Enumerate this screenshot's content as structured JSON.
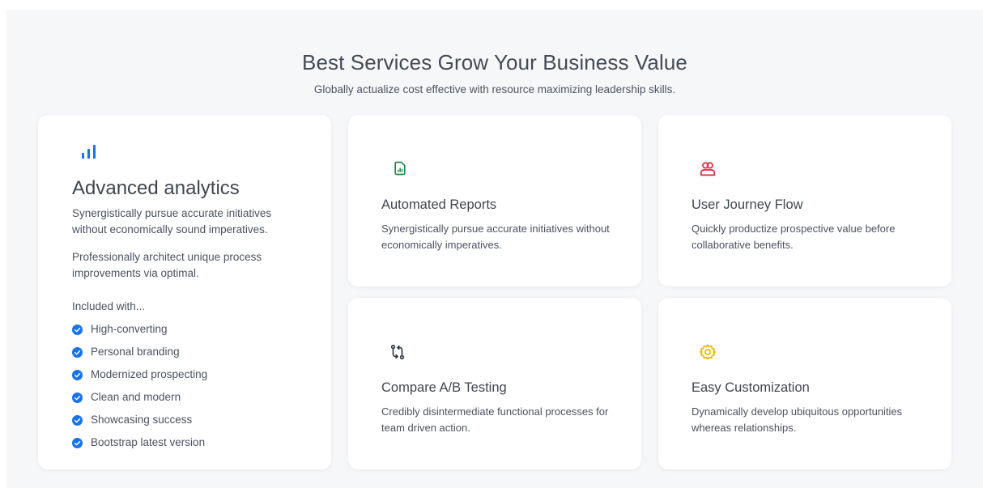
{
  "header": {
    "title": "Best Services Grow Your Business Value",
    "subtitle": "Globally actualize cost effective with resource maximizing leadership skills."
  },
  "featured": {
    "icon": "bar-chart-icon",
    "title": "Advanced analytics",
    "paragraph1": "Synergistically pursue accurate initiatives without economically sound imperatives.",
    "paragraph2": "Professionally architect unique process improvements via optimal.",
    "included_label": "Included with...",
    "features": [
      "High-converting",
      "Personal branding",
      "Modernized prospecting",
      "Clean and modern",
      "Showcasing success",
      "Bootstrap latest version"
    ]
  },
  "services": [
    {
      "icon": "file-chart-icon",
      "title": "Automated Reports",
      "desc": "Synergistically pursue accurate initiatives without economically imperatives."
    },
    {
      "icon": "users-icon",
      "title": "User Journey Flow",
      "desc": "Quickly productize prospective value before collaborative benefits."
    },
    {
      "icon": "git-compare-icon",
      "title": "Compare A/B Testing",
      "desc": "Credibly disintermediate functional processes for team driven action."
    },
    {
      "icon": "settings-gear-icon",
      "title": "Easy Customization",
      "desc": "Dynamically develop ubiquitous opportunities whereas relationships."
    }
  ],
  "colors": {
    "section_bg": "#f6f7f9",
    "card_bg": "#ffffff",
    "blue": "#1a73e8",
    "green": "#1e8a4c",
    "red": "#e0344a",
    "dark": "#343a40",
    "yellow": "#f0b400"
  }
}
